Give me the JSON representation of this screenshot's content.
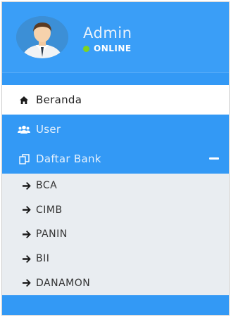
{
  "user": {
    "name": "Admin",
    "status": "ONLINE",
    "status_color": "#7ed321"
  },
  "menu": {
    "items": [
      {
        "label": "Beranda",
        "icon": "home-icon",
        "active": true
      },
      {
        "label": "User",
        "icon": "users-icon",
        "active": false
      },
      {
        "label": "Daftar Bank",
        "icon": "copy-icon",
        "active": false,
        "expanded": true,
        "toggle_icon": "minus-icon"
      }
    ],
    "submenu": [
      {
        "label": "BCA",
        "icon": "arrow-right-icon"
      },
      {
        "label": "CIMB",
        "icon": "arrow-right-icon"
      },
      {
        "label": "PANIN",
        "icon": "arrow-right-icon"
      },
      {
        "label": "BII",
        "icon": "arrow-right-icon"
      },
      {
        "label": "DANAMON",
        "icon": "arrow-right-icon"
      }
    ]
  },
  "colors": {
    "sidebar_bg": "#3399f5",
    "active_bg": "#ffffff",
    "submenu_bg": "#e9edf1"
  }
}
